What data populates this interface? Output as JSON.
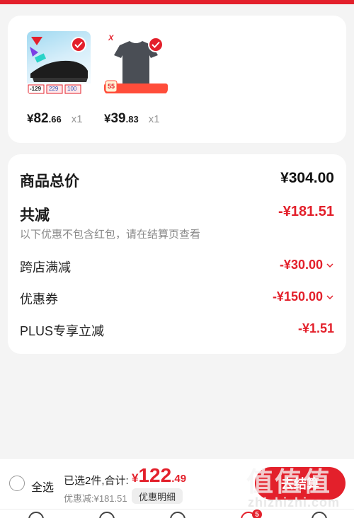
{
  "products": [
    {
      "name": "shoe",
      "price_symbol": "¥",
      "price_int": "82",
      "price_dec": ".66",
      "qty": "x1"
    },
    {
      "name": "tshirt",
      "price_symbol": "¥",
      "price_int": "39",
      "price_dec": ".83",
      "qty": "x1"
    }
  ],
  "thumb_text": {
    "shoe": [
      "-129",
      "229",
      "100"
    ],
    "shirt_badge": "55",
    "shirt_brand": "X"
  },
  "summary": {
    "total_label": "商品总价",
    "total_value": "¥304.00",
    "discount_label": "共减",
    "discount_value": "-¥181.51",
    "note": "以下优惠不包含红包，请在结算页查看",
    "items": [
      {
        "label": "跨店满减",
        "value": "-¥30.00"
      },
      {
        "label": "优惠券",
        "value": "-¥150.00"
      },
      {
        "label": "PLUS专享立减",
        "value": "-¥1.51"
      }
    ]
  },
  "bottom_bar": {
    "select_all": "全选",
    "selected_info": "已选2件,合计:",
    "price_symbol": "¥",
    "price_int": "122",
    "price_dec": ".49",
    "saved": "优惠减:¥181.51",
    "detail_button": "优惠明细",
    "settle_button": "去结算"
  },
  "tabbar": {
    "cart_badge": "5"
  },
  "watermark": {
    "main": "值值值",
    "sub": "zhizhizhi.com"
  },
  "colors": {
    "accent": "#e3202b",
    "background": "#f4f4f4"
  }
}
